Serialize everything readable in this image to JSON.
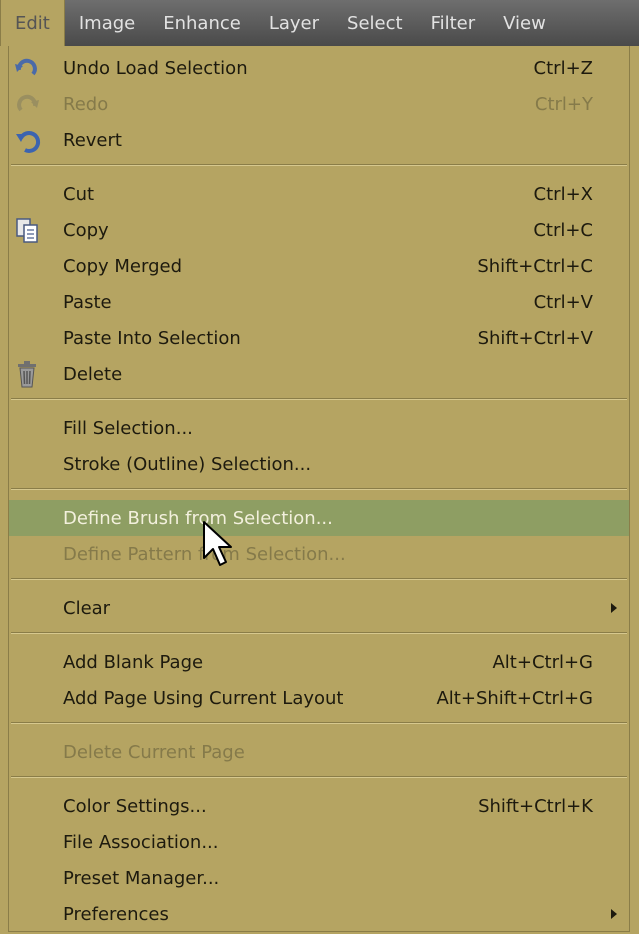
{
  "menubar": {
    "items": [
      "Edit",
      "Image",
      "Enhance",
      "Layer",
      "Select",
      "Filter",
      "View"
    ]
  },
  "menu": {
    "items": [
      {
        "label": "Undo Load Selection",
        "shortcut": "Ctrl+Z",
        "icon": "undo-icon"
      },
      {
        "label": "Redo",
        "shortcut": "Ctrl+Y",
        "icon": "redo-icon",
        "disabled": true
      },
      {
        "label": "Revert",
        "shortcut": "",
        "icon": "revert-icon"
      },
      {
        "label": "Cut",
        "shortcut": "Ctrl+X"
      },
      {
        "label": "Copy",
        "shortcut": "Ctrl+C",
        "icon": "copy-icon"
      },
      {
        "label": "Copy Merged",
        "shortcut": "Shift+Ctrl+C"
      },
      {
        "label": "Paste",
        "shortcut": "Ctrl+V"
      },
      {
        "label": "Paste Into Selection",
        "shortcut": "Shift+Ctrl+V"
      },
      {
        "label": "Delete",
        "shortcut": "",
        "icon": "trash-icon"
      },
      {
        "label": "Fill Selection...",
        "shortcut": ""
      },
      {
        "label": "Stroke (Outline) Selection...",
        "shortcut": ""
      },
      {
        "label": "Define Brush from Selection...",
        "shortcut": "",
        "highlighted": true
      },
      {
        "label": "Define Pattern from Selection...",
        "shortcut": "",
        "disabled": true
      },
      {
        "label": "Clear",
        "shortcut": "",
        "submenu": true
      },
      {
        "label": "Add Blank Page",
        "shortcut": "Alt+Ctrl+G"
      },
      {
        "label": "Add Page Using Current Layout",
        "shortcut": "Alt+Shift+Ctrl+G"
      },
      {
        "label": "Delete Current Page",
        "shortcut": "",
        "disabled": true
      },
      {
        "label": "Color Settings...",
        "shortcut": "Shift+Ctrl+K"
      },
      {
        "label": "File Association...",
        "shortcut": ""
      },
      {
        "label": "Preset Manager...",
        "shortcut": ""
      },
      {
        "label": "Preferences",
        "shortcut": "",
        "submenu": true
      }
    ]
  },
  "colors": {
    "menu_bg": "#b5a462",
    "highlight": "#8e9e63",
    "menubar_bg": "#5a5a5a"
  }
}
